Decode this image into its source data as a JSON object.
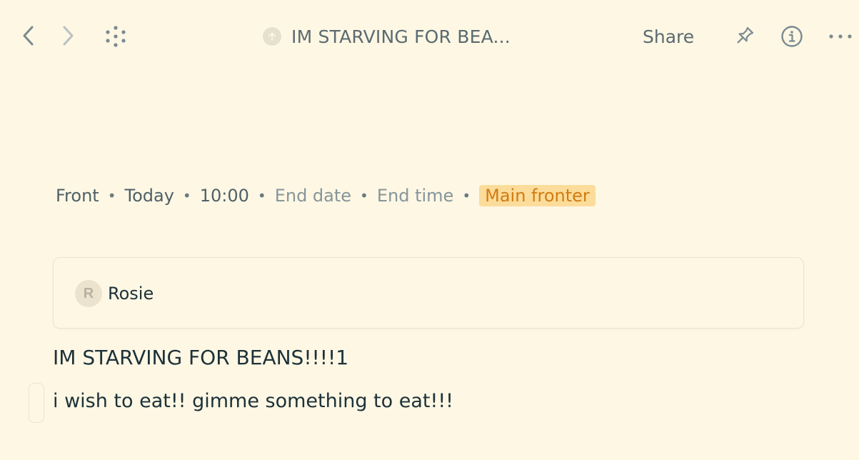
{
  "header": {
    "title": "IM STARVING FOR BEA...",
    "share_label": "Share",
    "icons": [
      "chevron-left-icon",
      "chevron-right-icon",
      "dots-grid-icon",
      "arrow-up-circle-icon",
      "pin-icon",
      "info-icon",
      "more-horizontal-icon"
    ]
  },
  "meta": {
    "type": "Front",
    "date": "Today",
    "time": "10:00",
    "end_date": "End date",
    "end_time": "End time",
    "tag": "Main fronter",
    "separator": "•"
  },
  "members": [
    {
      "initial": "R",
      "name": "Rosie"
    }
  ],
  "note": {
    "heading": "IM STARVING FOR BEANS!!!!1",
    "body": "i wish to eat!! gimme something to eat!!!"
  },
  "colors": {
    "background": "#fdf7e4",
    "tag_bg": "#fbdc9a",
    "tag_text": "#d27c10",
    "text": "#1d3138",
    "muted": "#86959a"
  }
}
